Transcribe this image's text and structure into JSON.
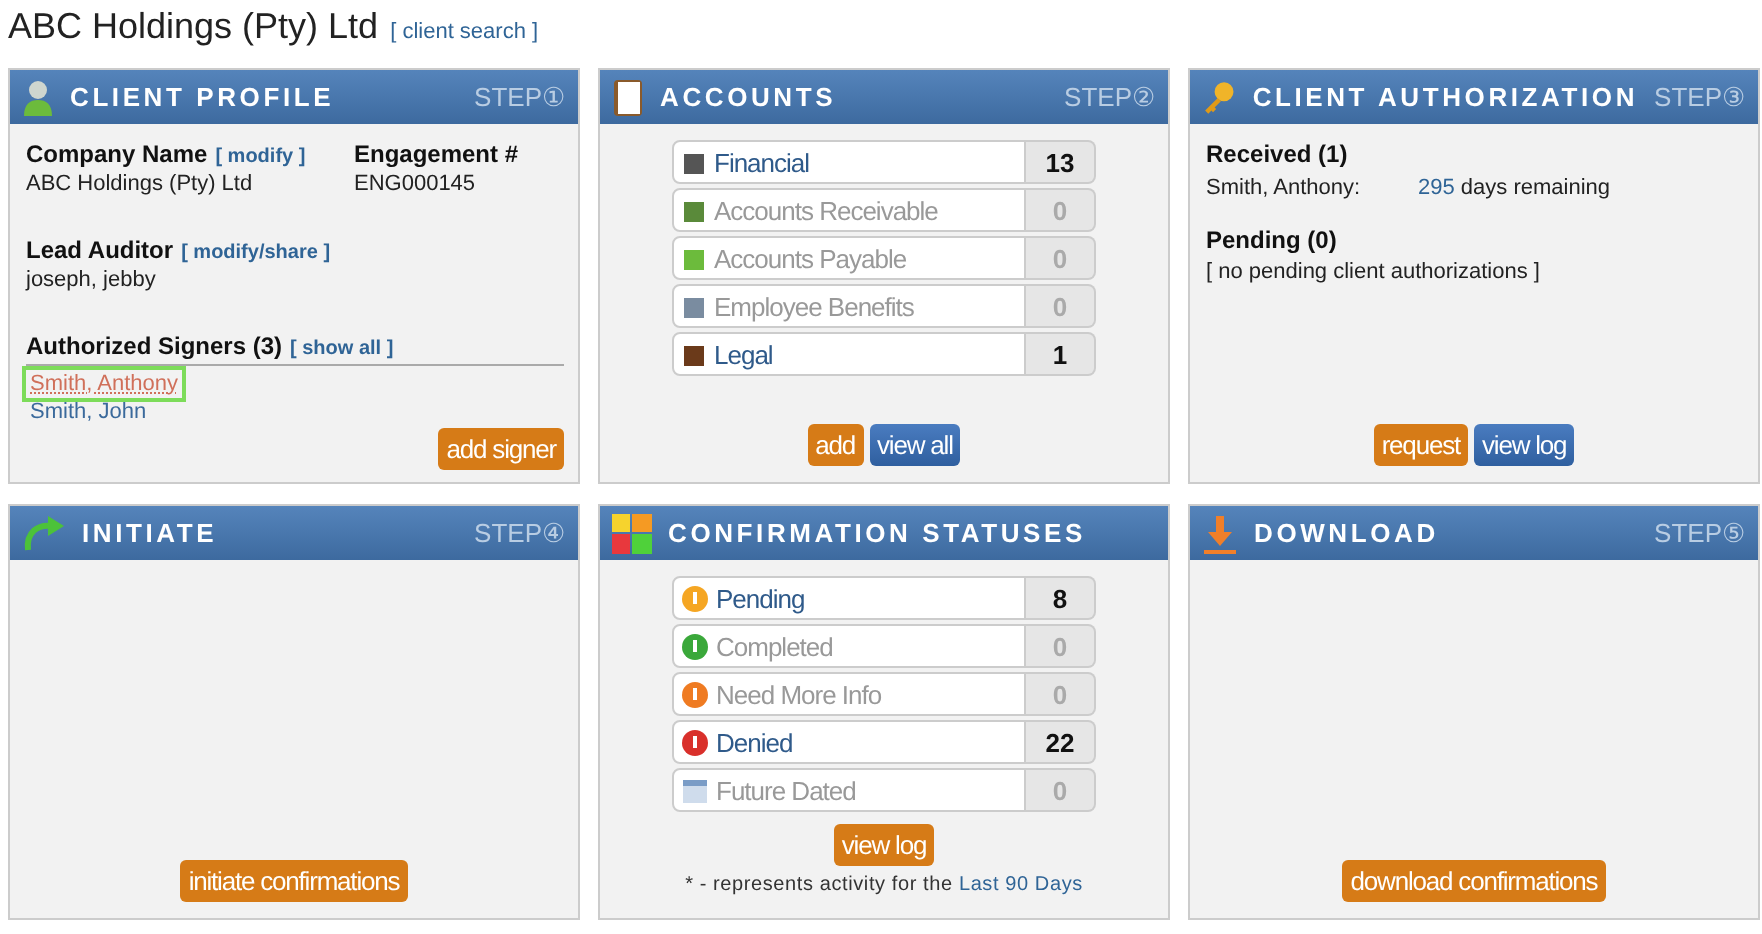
{
  "page_title": "ABC Holdings (Pty) Ltd",
  "title_link": "[ client search ]",
  "panels": [
    {
      "kind": "profile",
      "title": "CLIENT PROFILE",
      "step": "STEP",
      "step_number": "①",
      "company_label": "Company Name",
      "company_link": "[ modify ]",
      "company_value": "ABC Holdings (Pty) Ltd",
      "engagement_label": "Engagement #",
      "engagement_value": "ENG000145",
      "auditor_label": "Lead Auditor",
      "auditor_link": "[ modify/share ]",
      "auditor_value": "joseph, jebby",
      "signers_label": "Authorized Signers (3)",
      "signers_link": "[ show all ]",
      "signers": [
        {
          "name": "Smith, Anthony",
          "selected": true
        },
        {
          "name": "Smith, John",
          "selected": false
        }
      ],
      "buttons": [
        {
          "label": "add signer",
          "kind": "primary"
        }
      ]
    },
    {
      "kind": "accounts",
      "title": "ACCOUNTS",
      "step": "STEP",
      "step_number": "②",
      "rows": [
        {
          "label": "Financial",
          "count": "13",
          "active": true
        },
        {
          "label": "Accounts Receivable",
          "count": "0",
          "active": false
        },
        {
          "label": "Accounts Payable",
          "count": "0",
          "active": false
        },
        {
          "label": "Employee Benefits",
          "count": "0",
          "active": false
        },
        {
          "label": "Legal",
          "count": "1",
          "active": true
        }
      ],
      "buttons": [
        {
          "label": "add",
          "kind": "primary"
        },
        {
          "label": "view all",
          "kind": "secondary"
        }
      ]
    },
    {
      "kind": "authorization",
      "title": "CLIENT AUTHORIZATION",
      "step": "STEP",
      "step_number": "③",
      "received_label": "Received (1)",
      "received": [
        {
          "name": "Smith, Anthony:",
          "days": "295",
          "suffix": "days remaining"
        }
      ],
      "pending_label": "Pending (0)",
      "pending_note": "[ no pending client authorizations ]",
      "buttons": [
        {
          "label": "request",
          "kind": "primary"
        },
        {
          "label": "view log",
          "kind": "secondary"
        }
      ]
    },
    {
      "kind": "initiate",
      "title": "INITIATE",
      "step": "STEP",
      "step_number": "④",
      "buttons": [
        {
          "label": "initiate confirmations",
          "kind": "primary"
        }
      ]
    },
    {
      "kind": "statuses",
      "title": "CONFIRMATION STATUSES",
      "rows": [
        {
          "label": "Pending",
          "count": "8",
          "active": true
        },
        {
          "label": "Completed",
          "count": "0",
          "active": false
        },
        {
          "label": "Need More Info",
          "count": "0",
          "active": false
        },
        {
          "label": "Denied",
          "count": "22",
          "active": true
        },
        {
          "label": "Future Dated",
          "count": "0",
          "active": false
        }
      ],
      "buttons": [
        {
          "label": "view log",
          "kind": "primary"
        }
      ],
      "note": "* - represents activity for the",
      "note_link": "Last 90 Days"
    },
    {
      "kind": "download",
      "title": "DOWNLOAD",
      "step": "STEP",
      "step_number": "⑤",
      "buttons": [
        {
          "label": "download confirmations",
          "kind": "primary"
        }
      ]
    }
  ]
}
